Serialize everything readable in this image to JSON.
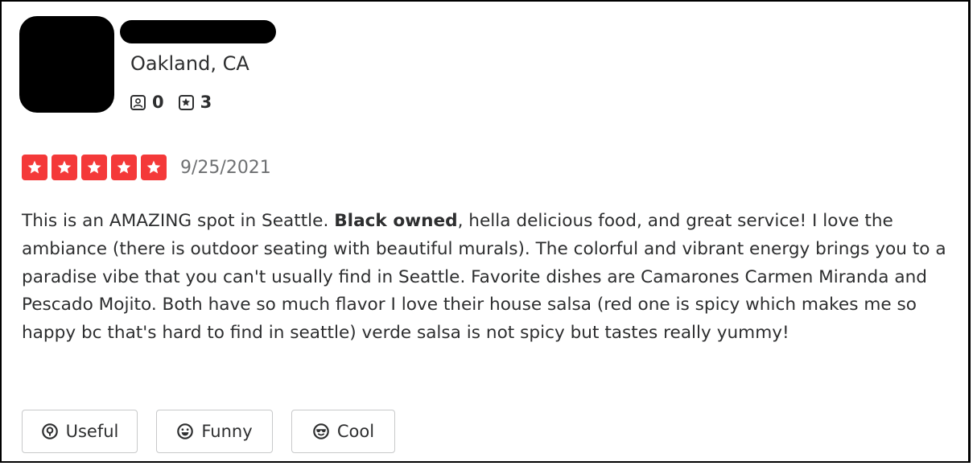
{
  "reviewer": {
    "location": "Oakland, CA",
    "friends_count": "0",
    "reviews_count": "3"
  },
  "review": {
    "rating": 5,
    "date": "9/25/2021",
    "text_before_bold": "This is an AMAZING spot in Seattle. ",
    "text_bold": "Black owned",
    "text_after_bold": ", hella delicious food, and great service! I love the ambiance (there is outdoor seating with beautiful murals). The colorful and vibrant energy brings you to a paradise vibe that you can't usually find in Seattle. Favorite dishes are Camarones Carmen Miranda and Pescado Mojito. Both have so much flavor I love their house salsa (red one is spicy which makes me so happy bc that's hard to find in seattle) verde salsa is not spicy but tastes really yummy!"
  },
  "actions": {
    "useful_label": "Useful",
    "funny_label": "Funny",
    "cool_label": "Cool"
  },
  "colors": {
    "star": "#f43939",
    "text": "#2d2e2f",
    "muted": "#6e7072",
    "button_border": "#c8c9ca"
  },
  "icons": {
    "friends": "friends-icon",
    "reviews": "review-star-icon",
    "useful": "lightbulb-icon",
    "funny": "smiley-icon",
    "cool": "sunglasses-icon"
  }
}
